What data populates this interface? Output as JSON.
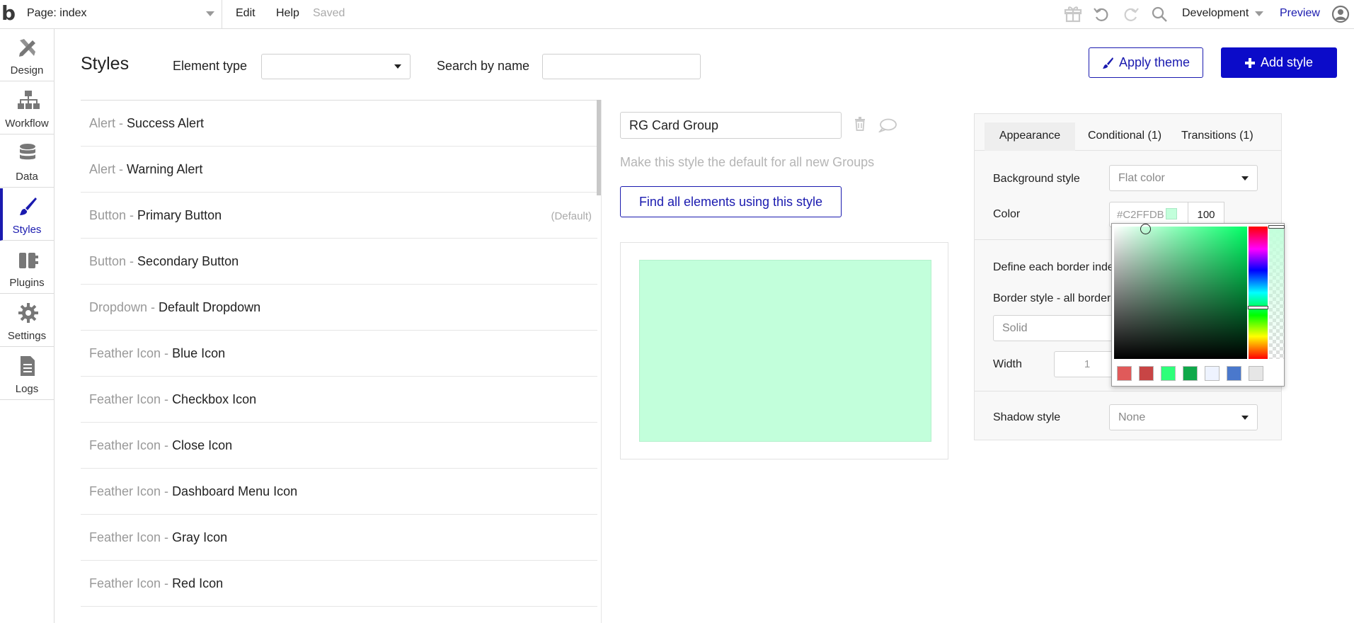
{
  "topbar": {
    "page_label": "Page: index",
    "menu_edit": "Edit",
    "menu_help": "Help",
    "saved_status": "Saved",
    "environment": "Development",
    "preview": "Preview"
  },
  "sidebar": {
    "items": [
      {
        "label": "Design",
        "icon": "design-icon"
      },
      {
        "label": "Workflow",
        "icon": "workflow-icon"
      },
      {
        "label": "Data",
        "icon": "data-icon"
      },
      {
        "label": "Styles",
        "icon": "styles-icon",
        "active": true
      },
      {
        "label": "Plugins",
        "icon": "plugins-icon"
      },
      {
        "label": "Settings",
        "icon": "settings-icon"
      },
      {
        "label": "Logs",
        "icon": "logs-icon"
      }
    ]
  },
  "header": {
    "title": "Styles",
    "element_type_label": "Element type",
    "element_type_value": "",
    "search_label": "Search by name",
    "search_value": "",
    "apply_theme": "Apply theme",
    "add_style": "Add style"
  },
  "styles_list": [
    {
      "type": "Alert - ",
      "name": "Success Alert",
      "default": ""
    },
    {
      "type": "Alert - ",
      "name": "Warning Alert",
      "default": ""
    },
    {
      "type": "Button - ",
      "name": "Primary Button",
      "default": "(Default)"
    },
    {
      "type": "Button - ",
      "name": "Secondary Button",
      "default": ""
    },
    {
      "type": "Dropdown - ",
      "name": "Default Dropdown",
      "default": ""
    },
    {
      "type": "Feather Icon - ",
      "name": "Blue Icon",
      "default": ""
    },
    {
      "type": "Feather Icon - ",
      "name": "Checkbox Icon",
      "default": ""
    },
    {
      "type": "Feather Icon - ",
      "name": "Close Icon",
      "default": ""
    },
    {
      "type": "Feather Icon - ",
      "name": "Dashboard Menu Icon",
      "default": ""
    },
    {
      "type": "Feather Icon - ",
      "name": "Gray Icon",
      "default": ""
    },
    {
      "type": "Feather Icon - ",
      "name": "Red Icon",
      "default": ""
    }
  ],
  "editor": {
    "style_name": "RG Card Group",
    "default_text": "Make this style the default for all new Groups",
    "find_button": "Find all elements using this style"
  },
  "panel": {
    "tabs": [
      "Appearance",
      "Conditional (1)",
      "Transitions (1)"
    ],
    "background_style_label": "Background style",
    "background_style_value": "Flat color",
    "color_label": "Color",
    "color_hex": "#C2FFDB",
    "color_opacity": "100",
    "define_border_label": "Define each border inde",
    "border_style_label": "Border style - all borders",
    "border_style_value": "Solid",
    "width_label": "Width",
    "width_value": "1",
    "shadow_style_label": "Shadow style",
    "shadow_style_value": "None"
  },
  "colors": {
    "accent": "#1a1aaf",
    "add_button": "#0b0bc9",
    "preview_fill": "#c2ffdb",
    "presets": [
      "#e05a5a",
      "#c84545",
      "#2eff7a",
      "#0fa84a",
      "#eef3ff",
      "#4a78cc",
      "#e6e6e6"
    ]
  }
}
